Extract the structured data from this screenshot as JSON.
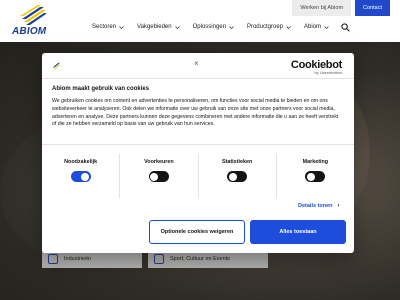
{
  "header": {
    "logo_text": "ABIOM",
    "work_label": "Werken bij Abiom",
    "contact_label": "Contact",
    "nav": [
      {
        "label": "Sectoren"
      },
      {
        "label": "Vakgebieden"
      },
      {
        "label": "Oplossingen"
      },
      {
        "label": "Productgroep"
      },
      {
        "label": "Abiom"
      }
    ]
  },
  "hero": {
    "cards": [
      {
        "label": "Industrieën"
      },
      {
        "label": "Sport, Cultuur en Events"
      }
    ]
  },
  "cookie_dialog": {
    "close_label": "×",
    "brand": "Cookiebot",
    "brand_sub": "by Usercentrics",
    "title": "Abiom maakt gebruik van cookies",
    "body": "We gebruiken cookies om content en advertenties te personaliseren, om functies voor social media te bieden en om ons websiteverkeer te analyseren. Ook delen we informatie over uw gebruik van onze site met onze partners voor social media, adverteren en analyse. Deze partners kunnen deze gegevens combineren met andere informatie die u aan ze heeft verstrekt of die ze hebben verzameld op basis van uw gebruik van hun services.",
    "toggles": [
      {
        "label": "Noodzakelijk",
        "state": "on"
      },
      {
        "label": "Voorkeuren",
        "state": "off"
      },
      {
        "label": "Statistieken",
        "state": "off"
      },
      {
        "label": "Marketing",
        "state": "off"
      }
    ],
    "details_label": "Details tonen",
    "details_arrow": "›",
    "customize_label": "Optionele cookies weigeren",
    "allow_label": "Alles toestaan"
  },
  "colors": {
    "accent": "#1e4ddb",
    "brand_blue": "#1a3f8f",
    "logo_yellow": "#f2c500"
  }
}
